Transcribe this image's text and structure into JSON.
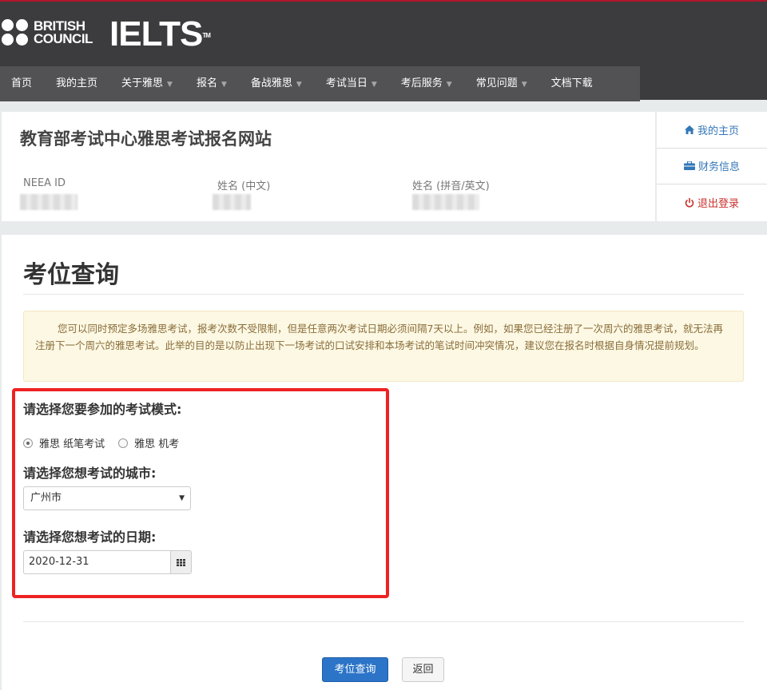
{
  "header": {
    "brand_line1": "BRITISH",
    "brand_line2": "COUNCIL",
    "product": "IELTS",
    "trademark": "TM"
  },
  "nav": {
    "items": [
      {
        "label": "首页",
        "dropdown": false
      },
      {
        "label": "我的主页",
        "dropdown": false
      },
      {
        "label": "关于雅思",
        "dropdown": true
      },
      {
        "label": "报名",
        "dropdown": true
      },
      {
        "label": "备战雅思",
        "dropdown": true
      },
      {
        "label": "考试当日",
        "dropdown": true
      },
      {
        "label": "考后服务",
        "dropdown": true
      },
      {
        "label": "常见问题",
        "dropdown": true
      },
      {
        "label": "文档下载",
        "dropdown": false
      }
    ],
    "caret": "▼"
  },
  "profile": {
    "site_title": "教育部考试中心雅思考试报名网站",
    "fields": [
      {
        "label": "NEEA ID"
      },
      {
        "label": "姓名 (中文)"
      },
      {
        "label": "姓名 (拼音/英文)"
      }
    ]
  },
  "side_menu": {
    "items": [
      {
        "label": "我的主页",
        "icon": "home-icon"
      },
      {
        "label": "财务信息",
        "icon": "briefcase-icon"
      },
      {
        "label": "退出登录",
        "icon": "power-icon"
      }
    ]
  },
  "main": {
    "title": "考位查询",
    "notice": "您可以同时预定多场雅思考试，报考次数不受限制，但是任意两次考试日期必须间隔7天以上。例如，如果您已经注册了一次周六的雅思考试，就无法再注册下一个周六的雅思考试。此举的目的是以防止出现下一场考试的口试安排和本场考试的笔试时间冲突情况，建议您在报名时根据自身情况提前规划。",
    "mode_label": "请选择您要参加的考试模式:",
    "modes": [
      {
        "label": "雅思 纸笔考试",
        "selected": true
      },
      {
        "label": "雅思 机考",
        "selected": false
      }
    ],
    "city_label": "请选择您想考试的城市:",
    "city_value": "广州市",
    "date_label": "请选择您想考试的日期:",
    "date_value": "2020-12-31",
    "search_button": "考位查询",
    "back_button": "返回"
  },
  "colors": {
    "header_bg": "#3c3c3e",
    "nav_bg": "#525254",
    "primary": "#2b74c8",
    "notice_bg": "#fcf8e3",
    "highlight": "#ee2222",
    "logout": "#c9302c"
  }
}
